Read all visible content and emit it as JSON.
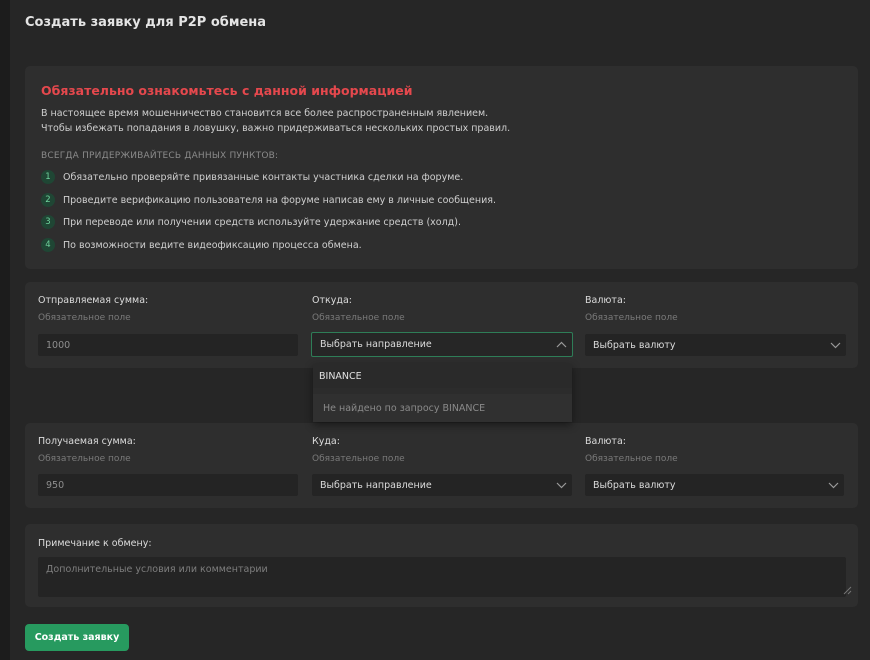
{
  "page": {
    "title": "Создать заявку для P2P обмена"
  },
  "info": {
    "title": "Обязательно ознакомьтесь с данной информацией",
    "lines": [
      "В настоящее время мошенничество становится все более распространенным явлением.",
      "Чтобы избежать попадания в ловушку, важно придерживаться нескольких простых правил."
    ],
    "caption": "ВСЕГДА ПРИДЕРЖИВАЙТЕСЬ ДАННЫХ ПУНКТОВ:",
    "rules": [
      {
        "num": "1",
        "text": "Обязательно проверяйте привязанные контакты участника сделки на форуме."
      },
      {
        "num": "2",
        "text": "Проведите верификацию пользователя на форуме написав ему в личные сообщения."
      },
      {
        "num": "3",
        "text": "При переводе или получении средств используйте удержание средств (холд)."
      },
      {
        "num": "4",
        "text": "По возможности ведите видеофиксацию процесса обмена."
      }
    ]
  },
  "send": {
    "amount_label": "Отправляемая сумма:",
    "amount_hint": "Обязательное поле",
    "amount_value": "1000",
    "from_label": "Откуда:",
    "from_hint": "Обязательное поле",
    "from_value": "Выбрать направление",
    "currency_label": "Валюта:",
    "currency_hint": "Обязательное поле",
    "currency_value": "Выбрать валюту"
  },
  "dropdown": {
    "search_text": "BINANCE",
    "empty_text": "Не найдено по запросу BINANCE"
  },
  "receive": {
    "amount_label": "Получаемая сумма:",
    "amount_hint": "Обязательное поле",
    "amount_value": "950",
    "to_label": "Куда:",
    "to_hint": "Обязательное поле",
    "to_value": "Выбрать направление",
    "currency_label": "Валюта:",
    "currency_hint": "Обязательное поле",
    "currency_value": "Выбрать валюту"
  },
  "note": {
    "label": "Примечание к обмену:",
    "placeholder": "Дополнительные условия или комментарии"
  },
  "submit_label": "Создать заявку",
  "colors": {
    "accent": "#279a5f",
    "warning": "#e5484d",
    "background": "#262626",
    "card": "#2e2e2e"
  },
  "icons": {
    "select_open": "chevron-up-icon",
    "select_closed": "chevron-down-icon"
  }
}
